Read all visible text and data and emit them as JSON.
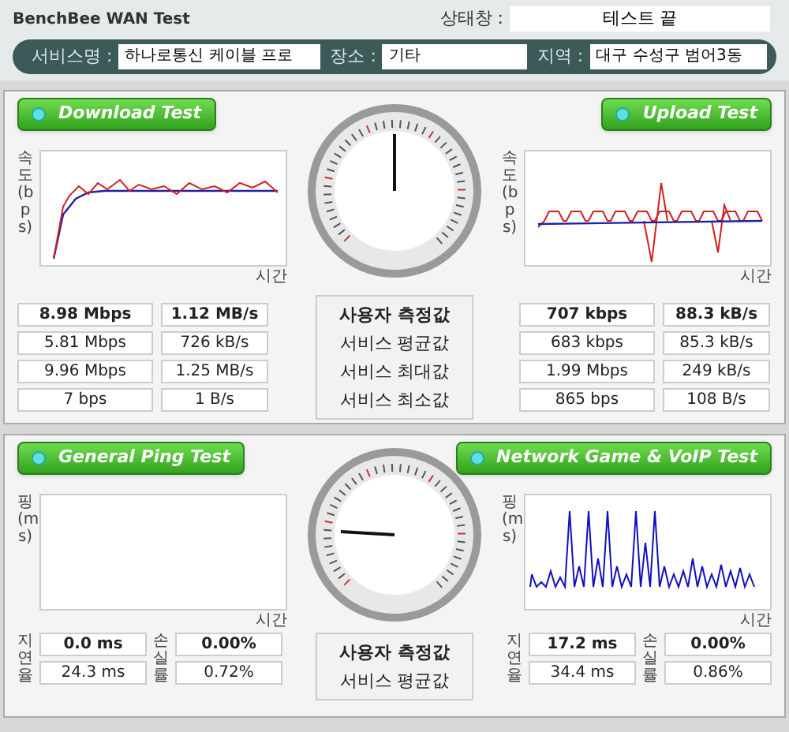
{
  "header": {
    "title": "BenchBee WAN Test",
    "status_label": "상태창 :",
    "status_value": "테스트 끝",
    "fields": [
      {
        "label": "서비스명 :",
        "value": "하나로통신 케이블 프로"
      },
      {
        "label": "장소 :",
        "value": "기타"
      },
      {
        "label": "지역 :",
        "value": "대구 수성구 범어3동"
      }
    ]
  },
  "speed": {
    "row_labels": [
      "사용자 측정값",
      "서비스 평균값",
      "서비스 최대값",
      "서비스 최소값"
    ],
    "download": {
      "button": "Download Test",
      "ylabel": "속도(bps)",
      "xlabel": "시간",
      "rows": [
        [
          "8.98 Mbps",
          "1.12 MB/s"
        ],
        [
          "5.81 Mbps",
          "726 kB/s"
        ],
        [
          "9.96 Mbps",
          "1.25 MB/s"
        ],
        [
          "7 bps",
          "1 B/s"
        ]
      ]
    },
    "upload": {
      "button": "Upload Test",
      "ylabel": "속도(bps)",
      "xlabel": "시간",
      "rows": [
        [
          "707 kbps",
          "88.3 kB/s"
        ],
        [
          "683 kbps",
          "85.3 kB/s"
        ],
        [
          "1.99 Mbps",
          "249 kB/s"
        ],
        [
          "865 bps",
          "108 B/s"
        ]
      ]
    }
  },
  "ping": {
    "row_labels": [
      "사용자 측정값",
      "서비스 평균값"
    ],
    "general": {
      "button": "General Ping Test",
      "ylabel": "핑(ms)",
      "xlabel": "시간",
      "delay_label": "지연율",
      "loss_label": "손실률",
      "rows": [
        [
          "0.0 ms",
          "0.00%"
        ],
        [
          "24.3 ms",
          "0.72%"
        ]
      ]
    },
    "game": {
      "button": "Network Game & VoIP Test",
      "ylabel": "핑(ms)",
      "xlabel": "시간",
      "delay_label": "지연율",
      "loss_label": "손실률",
      "rows": [
        [
          "17.2 ms",
          "0.00%"
        ],
        [
          "34.4 ms",
          "0.86%"
        ]
      ]
    }
  }
}
